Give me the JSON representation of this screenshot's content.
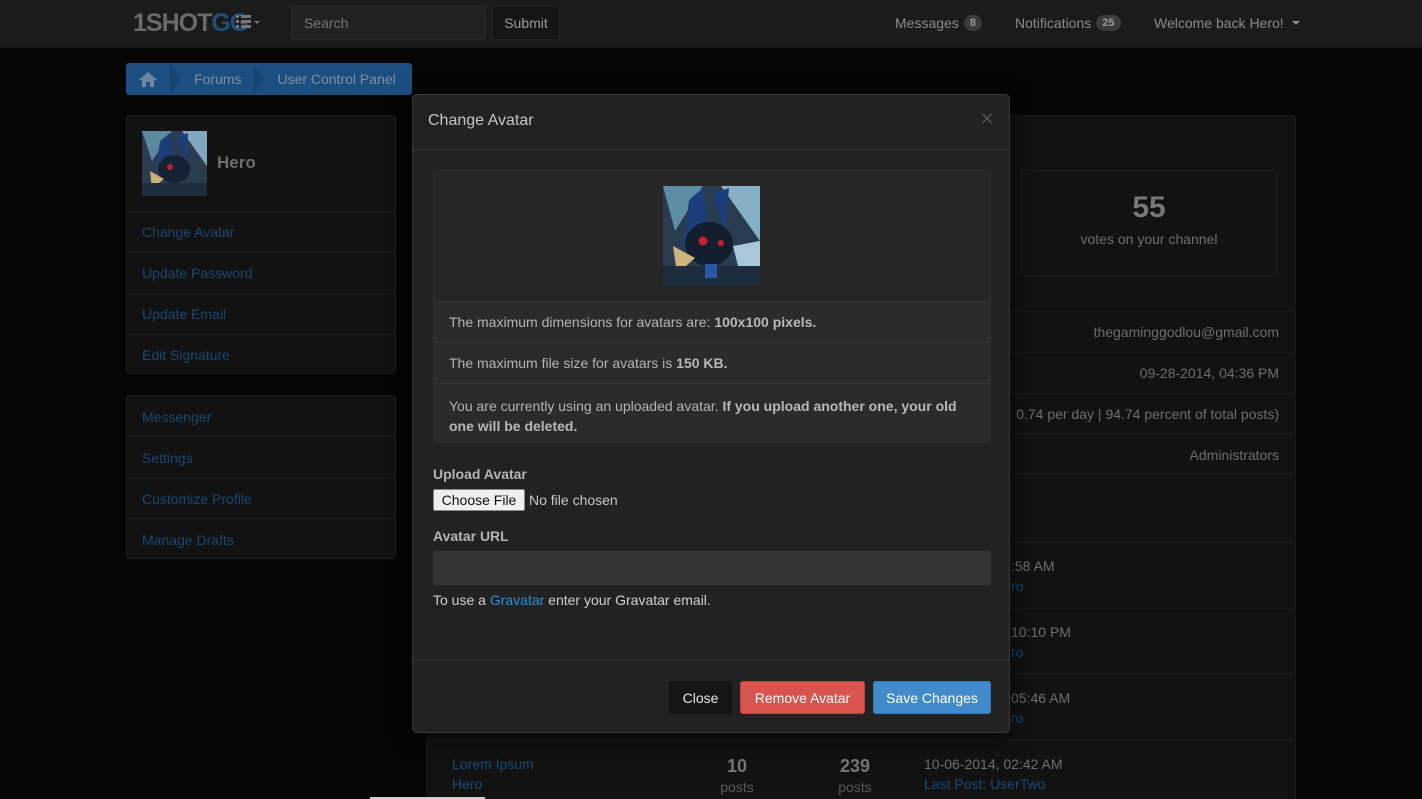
{
  "navbar": {
    "brand_part1": "1SHOT",
    "brand_part2": "GG",
    "search_placeholder": "Search",
    "submit_label": "Submit",
    "messages_label": "Messages",
    "messages_count": "8",
    "notifications_label": "Notifications",
    "notifications_count": "25",
    "welcome_label": "Welcome back Hero!"
  },
  "breadcrumb": {
    "items": [
      "Forums",
      "User Control Panel"
    ]
  },
  "sidebar": {
    "username": "Hero",
    "profile_links": [
      "Change Avatar",
      "Update Password",
      "Update Email",
      "Edit Signature"
    ],
    "account_links": [
      "Messenger",
      "Settings",
      "Customize Profile",
      "Manage Drafts"
    ]
  },
  "main": {
    "stat_value": "55",
    "stat_label": "votes on your channel",
    "email": "thegaminggodlou@gmail.com",
    "joined": "09-28-2014, 04:36 PM",
    "posts_stat": "0.74 per day | 94.74 percent of total posts)",
    "group": "Administrators",
    "recent_rows": [
      {
        "time": ":58 AM",
        "link": "ro"
      },
      {
        "time": "10:10 PM",
        "link": "ro"
      },
      {
        "time": "05:46 AM",
        "link": "ro"
      }
    ],
    "last_row": {
      "title": "Lorem Ipsum",
      "author": "Hero",
      "replies": "10",
      "replies_label": "posts",
      "views": "239",
      "views_label": "posts",
      "time": "10-06-2014, 02:42 AM",
      "last_post": "Last Post: UserTwo"
    }
  },
  "modal": {
    "title": "Change Avatar",
    "close_symbol": "×",
    "info": {
      "dimensions_prefix": "The maximum dimensions for avatars are: ",
      "dimensions_value": "100x100 pixels.",
      "size_prefix": "The maximum file size for avatars is ",
      "size_value": "150 KB.",
      "current_prefix": "You are currently using an uploaded avatar. ",
      "current_warning": "If you upload another one, your old one will be deleted."
    },
    "upload_label": "Upload Avatar",
    "choose_file_label": "Choose File",
    "no_file_text": "No file chosen",
    "url_label": "Avatar URL",
    "url_value": "",
    "help_prefix": "To use a ",
    "help_link": "Gravatar",
    "help_suffix": " enter your Gravatar email.",
    "close_label": "Close",
    "remove_label": "Remove Avatar",
    "save_label": "Save Changes"
  },
  "colors": {
    "primary": "#428bca",
    "danger": "#d9534f",
    "link": "#2a8fd8",
    "modal_bg": "#222222"
  }
}
